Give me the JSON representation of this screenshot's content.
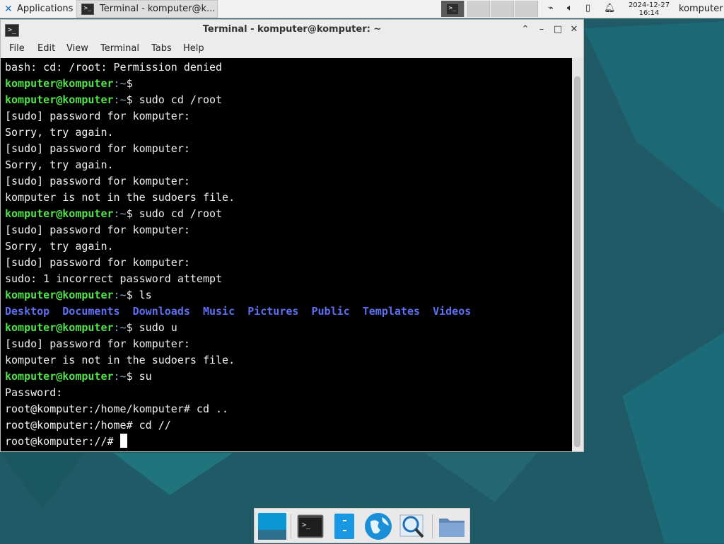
{
  "top_panel": {
    "applications_label": "Applications",
    "task_label": "Terminal - komputer@k...",
    "clock_date": "2024-12-27",
    "clock_time": "16:14",
    "user_label": "komputer"
  },
  "window": {
    "title": "Terminal - komputer@komputer: ~",
    "menu": [
      "File",
      "Edit",
      "View",
      "Terminal",
      "Tabs",
      "Help"
    ]
  },
  "terminal": {
    "prompt_user": "komputer@komputer",
    "prompt_path": ":~",
    "prompt_symbol": "$ ",
    "lines": [
      {
        "type": "out",
        "text": "bash: cd: /root: Permission denied"
      },
      {
        "type": "prompt",
        "cmd": ""
      },
      {
        "type": "prompt",
        "cmd": "sudo cd /root"
      },
      {
        "type": "out",
        "text": "[sudo] password for komputer:"
      },
      {
        "type": "out",
        "text": "Sorry, try again."
      },
      {
        "type": "out",
        "text": "[sudo] password for komputer:"
      },
      {
        "type": "out",
        "text": "Sorry, try again."
      },
      {
        "type": "out",
        "text": "[sudo] password for komputer:"
      },
      {
        "type": "out",
        "text": "komputer is not in the sudoers file."
      },
      {
        "type": "prompt",
        "cmd": "sudo cd /root"
      },
      {
        "type": "out",
        "text": "[sudo] password for komputer:"
      },
      {
        "type": "out",
        "text": "Sorry, try again."
      },
      {
        "type": "out",
        "text": "[sudo] password for komputer:"
      },
      {
        "type": "out",
        "text": "sudo: 1 incorrect password attempt"
      },
      {
        "type": "prompt",
        "cmd": "ls"
      },
      {
        "type": "dirs",
        "items": [
          "Desktop",
          "Documents",
          "Downloads",
          "Music",
          "Pictures",
          "Public",
          "Templates",
          "Videos"
        ]
      },
      {
        "type": "prompt",
        "cmd": "sudo u"
      },
      {
        "type": "out",
        "text": "[sudo] password for komputer:"
      },
      {
        "type": "out",
        "text": "komputer is not in the sudoers file."
      },
      {
        "type": "prompt",
        "cmd": "su"
      },
      {
        "type": "out",
        "text": "Password:"
      },
      {
        "type": "out",
        "text": "root@komputer:/home/komputer# cd .."
      },
      {
        "type": "out",
        "text": "root@komputer:/home# cd //"
      },
      {
        "type": "root",
        "text": "root@komputer://# "
      }
    ]
  },
  "dock": {
    "icons": [
      "desktop-icon",
      "terminal-icon",
      "file-manager-icon",
      "web-browser-icon",
      "app-finder-icon",
      "folder-icon"
    ]
  },
  "colors": {
    "prompt_user": "#52e14c",
    "prompt_path": "#7aa7c8",
    "directory": "#5d6ff0",
    "desktop_bg": "#1f5a66"
  }
}
